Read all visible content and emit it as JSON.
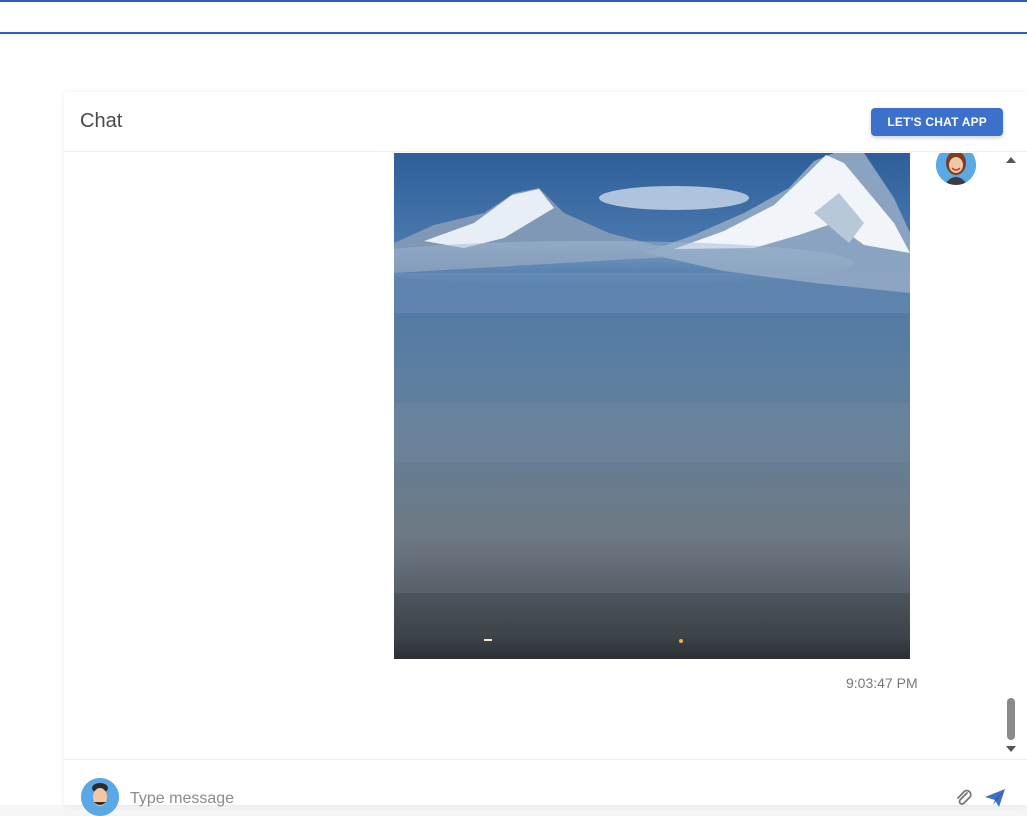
{
  "chat": {
    "title": "Chat",
    "brand_button": "LET'S CHAT APP"
  },
  "messages": [
    {
      "type": "image",
      "image_description": "snow-capped mountain peaks above a misty blue valley",
      "time": "9:03:47 PM",
      "avatar": "woman-avatar"
    }
  ],
  "composer": {
    "placeholder": "Type message",
    "value": "",
    "avatar": "man-avatar",
    "icons": [
      "paperclip-icon",
      "send-icon"
    ]
  },
  "colors": {
    "brand": "#3b71ca",
    "topbar_border": "#2f5fae"
  }
}
